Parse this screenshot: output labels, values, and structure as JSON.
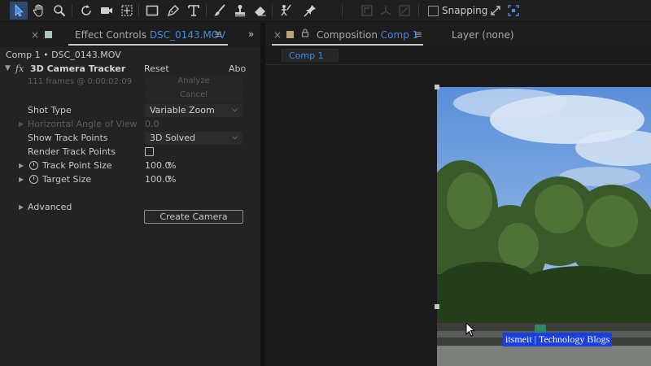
{
  "toolbar": {
    "tools": [
      "selection-tool-icon",
      "hand-tool-icon",
      "zoom-tool-icon",
      "rotate-tool-icon",
      "camera-tool-icon",
      "pan-behind-tool-icon",
      "rectangle-tool-icon",
      "pen-tool-icon",
      "type-tool-icon",
      "brush-tool-icon",
      "clone-stamp-tool-icon",
      "eraser-tool-icon",
      "roto-brush-tool-icon",
      "puppet-pin-tool-icon"
    ],
    "snapping_label": "Snapping",
    "snapping_checked": false
  },
  "effect_panel": {
    "tab_prefix": "Effect Controls",
    "tab_file": "DSC_0143.MOV",
    "swatch_color": "#a7c7b9",
    "breadcrumb": "Comp 1 • DSC_0143.MOV",
    "effect_name": "3D Camera Tracker",
    "fx_label": "fx",
    "reset_label": "Reset",
    "about_label": "Abo",
    "status": "111 frames @ 0:00:02:09",
    "analyze_label": "Analyze",
    "cancel_label": "Cancel",
    "shot_type_label": "Shot Type",
    "shot_type_value": "Variable Zoom",
    "horizontal_angle_label": "Horizontal Angle of View",
    "horizontal_angle_value": "0.0",
    "show_track_points_label": "Show Track Points",
    "show_track_points_value": "3D Solved",
    "render_track_points_label": "Render Track Points",
    "render_track_points_checked": false,
    "track_point_size_label": "Track Point Size",
    "track_point_size_value": "100.0",
    "target_size_label": "Target Size",
    "target_size_value": "100.0",
    "percent": "%",
    "create_camera_label": "Create Camera",
    "advanced_label": "Advanced"
  },
  "comp_panel": {
    "tab_prefix": "Composition",
    "tab_comp": "Comp 1",
    "swatch_color": "#b7a67c",
    "layer_tab": "Layer (none)",
    "subtab": "Comp 1"
  },
  "watermark": "itsmeit | Technology Blogs",
  "colors": {
    "accent_blue": "#3d8ee6",
    "active_tool": "#2e4a73",
    "watermark_bg": "#1a3ee0"
  }
}
